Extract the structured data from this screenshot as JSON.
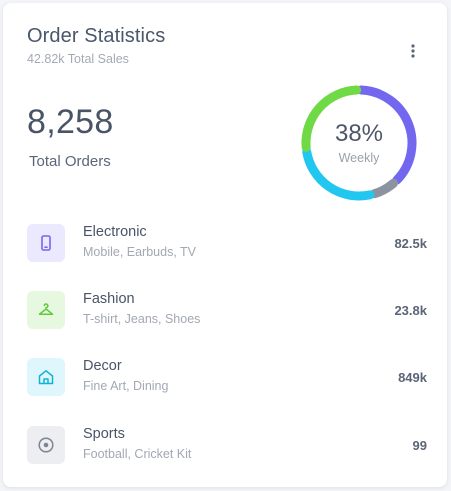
{
  "card": {
    "title": "Order Statistics",
    "subtitle": "42.82k Total Sales",
    "menu_icon": "more-vertical-icon"
  },
  "summary": {
    "total_orders": "8,258",
    "total_orders_label": "Total Orders"
  },
  "donut": {
    "percent_label": "38%",
    "period_label": "Weekly",
    "segments": [
      {
        "name": "Electronic",
        "fraction": 0.38,
        "color": "#7367f0"
      },
      {
        "name": "Sports",
        "fraction": 0.08,
        "color": "#8b93a1"
      },
      {
        "name": "Decor",
        "fraction": 0.27,
        "color": "#22c7f0"
      },
      {
        "name": "Fashion",
        "fraction": 0.27,
        "color": "#6fd946"
      }
    ]
  },
  "categories": [
    {
      "name": "Electronic",
      "desc": "Mobile, Earbuds, TV",
      "value": "82.5k",
      "icon": "mobile-icon",
      "color": "#7367f0",
      "bg": "#ebe9fd"
    },
    {
      "name": "Fashion",
      "desc": "T-shirt, Jeans, Shoes",
      "value": "23.8k",
      "icon": "hanger-icon",
      "color": "#62c93a",
      "bg": "#e7f8e1"
    },
    {
      "name": "Decor",
      "desc": "Fine Art, Dining",
      "value": "849k",
      "icon": "home-icon",
      "color": "#0fb3d8",
      "bg": "#dff6fc"
    },
    {
      "name": "Sports",
      "desc": "Football, Cricket Kit",
      "value": "99",
      "icon": "football-icon",
      "color": "#7d8594",
      "bg": "#eceef1"
    }
  ]
}
